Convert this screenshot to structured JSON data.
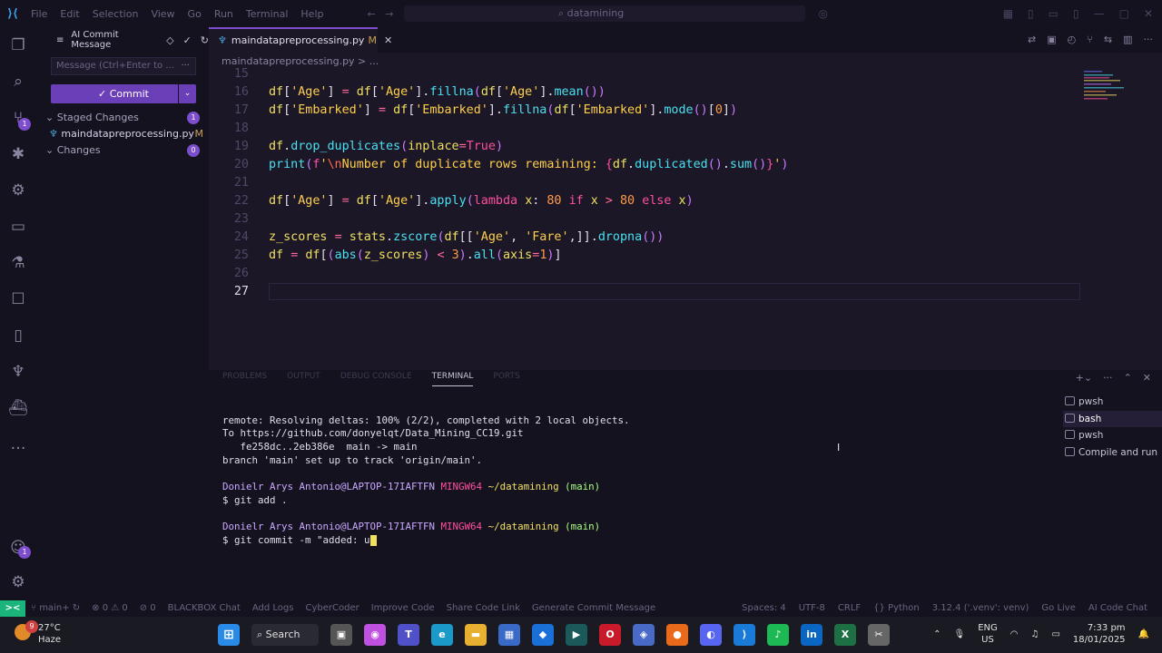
{
  "titlebar": {
    "menu": [
      "File",
      "Edit",
      "Selection",
      "View",
      "Go",
      "Run",
      "Terminal",
      "Help"
    ],
    "search": "datamining"
  },
  "scm": {
    "header": "AI Commit Message",
    "message_placeholder": "Message (Ctrl+Enter to ...",
    "commit_label": "✓ Commit",
    "staged_label": "Staged Changes",
    "staged_count": "1",
    "staged_file": "maindatapreprocessing.py",
    "staged_file_status": "M",
    "changes_label": "Changes",
    "changes_count": "0",
    "scm_badge": "1",
    "account_badge": "1"
  },
  "tab": {
    "name": "maindatapreprocessing.py",
    "status": "M"
  },
  "breadcrumb": "maindatapreprocessing.py  >  ...",
  "editor": {
    "lines": [
      {
        "n": "15",
        "t": ""
      },
      {
        "n": "16",
        "t": "df['Age'] = df['Age'].fillna(df['Age'].mean())"
      },
      {
        "n": "17",
        "t": "df['Embarked'] = df['Embarked'].fillna(df['Embarked'].mode()[0])"
      },
      {
        "n": "18",
        "t": ""
      },
      {
        "n": "19",
        "t": "df.drop_duplicates(inplace=True)"
      },
      {
        "n": "20",
        "t": "print(f'\\nNumber of duplicate rows remaining: {df.duplicated().sum()}')"
      },
      {
        "n": "21",
        "t": ""
      },
      {
        "n": "22",
        "t": "df['Age'] = df['Age'].apply(lambda x: 80 if x > 80 else x)"
      },
      {
        "n": "23",
        "t": ""
      },
      {
        "n": "24",
        "t": "z_scores = stats.zscore(df[['Age', 'Fare',]].dropna())"
      },
      {
        "n": "25",
        "t": "df = df[(abs(z_scores) < 3).all(axis=1)]"
      },
      {
        "n": "26",
        "t": ""
      },
      {
        "n": "27",
        "t": ""
      }
    ]
  },
  "panel": {
    "tabs": [
      "PROBLEMS",
      "OUTPUT",
      "DEBUG CONSOLE",
      "TERMINAL",
      "PORTS"
    ],
    "terminal": {
      "l1": "remote: Resolving deltas: 100% (2/2), completed with 2 local objects.",
      "l2": "To https://github.com/donyelqt/Data_Mining_CC19.git",
      "l3": "   fe258dc..2eb386e  main -> main",
      "l4": "branch 'main' set up to track 'origin/main'.",
      "user": "Donielr Arys Antonio@LAPTOP-17IAFTFN",
      "sys": "MINGW64",
      "path": "~/datamining",
      "branch": "(main)",
      "cmd1": "$ git add .",
      "cmd2": "$ git commit -m \"added: u"
    },
    "terminals": [
      "pwsh",
      "bash",
      "pwsh",
      "Compile and run"
    ]
  },
  "status": {
    "branch": "main+",
    "errors": "⊗ 0 ⚠ 0",
    "ports": "⊘ 0",
    "left_items": [
      "BLACKBOX Chat",
      "Add Logs",
      "CyberCoder",
      "Improve Code",
      "Share Code Link",
      "Generate Commit Message"
    ],
    "right_items": [
      "Spaces: 4",
      "UTF-8",
      "CRLF",
      "{} Python",
      "3.12.4 ('.venv': venv)",
      "Go Live",
      "AI Code Chat"
    ]
  },
  "taskbar": {
    "temp": "27°C",
    "weather": "Haze",
    "weather_badge": "9",
    "search": "Search",
    "lang1": "ENG",
    "lang2": "US",
    "time": "7:33 pm",
    "date": "18/01/2025"
  }
}
